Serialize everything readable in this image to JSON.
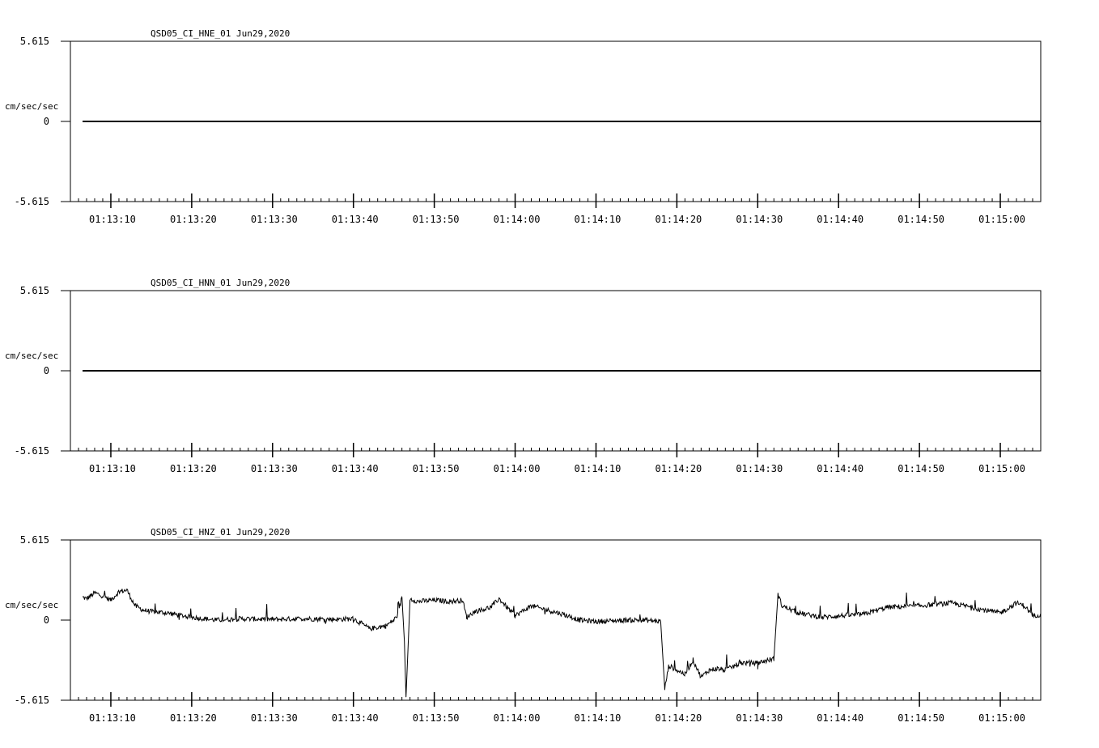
{
  "chart_data": [
    {
      "type": "line",
      "title": "QSD05_CI_HNE_01  Jun29,2020",
      "ylabel": "cm/sec/sec",
      "ylim": [
        -5.615,
        5.615
      ],
      "ytick_labels": [
        "5.615",
        "0",
        "-5.615"
      ],
      "xlim": [
        "01:13:05",
        "01:15:05"
      ],
      "xtick_labels": [
        "01:13:10",
        "01:13:20",
        "01:13:30",
        "01:13:40",
        "01:13:50",
        "01:14:00",
        "01:14:10",
        "01:14:20",
        "01:14:30",
        "01:14:40",
        "01:14:50",
        "01:15:00"
      ],
      "series": [
        {
          "x": [
            "01:13:06.5",
            "01:15:05"
          ],
          "y": [
            0,
            0
          ]
        }
      ]
    },
    {
      "type": "line",
      "title": "QSD05_CI_HNN_01  Jun29,2020",
      "ylabel": "cm/sec/sec",
      "ylim": [
        -5.615,
        5.615
      ],
      "ytick_labels": [
        "5.615",
        "0",
        "-5.615"
      ],
      "xlim": [
        "01:13:05",
        "01:15:05"
      ],
      "xtick_labels": [
        "01:13:10",
        "01:13:20",
        "01:13:30",
        "01:13:40",
        "01:13:50",
        "01:14:00",
        "01:14:10",
        "01:14:20",
        "01:14:30",
        "01:14:40",
        "01:14:50",
        "01:15:00"
      ],
      "series": [
        {
          "x": [
            "01:13:06.5",
            "01:15:05"
          ],
          "y": [
            0,
            0
          ]
        }
      ]
    },
    {
      "type": "line",
      "title": "QSD05_CI_HNZ_01  Jun29,2020",
      "ylabel": "cm/sec/sec",
      "ylim": [
        -5.615,
        5.615
      ],
      "ytick_labels": [
        "5.615",
        "0",
        "-5.615"
      ],
      "xlim": [
        "01:13:05",
        "01:15:05"
      ],
      "xtick_labels": [
        "01:13:10",
        "01:13:20",
        "01:13:30",
        "01:13:40",
        "01:13:50",
        "01:14:00",
        "01:14:10",
        "01:14:20",
        "01:14:30",
        "01:14:40",
        "01:14:50",
        "01:15:00"
      ],
      "series": [
        {
          "x": [
            "01:13:06.5",
            "01:13:07",
            "01:13:08",
            "01:13:09",
            "01:13:10",
            "01:13:11",
            "01:13:12",
            "01:13:13",
            "01:13:14",
            "01:13:15",
            "01:13:17",
            "01:13:20",
            "01:13:23",
            "01:13:26",
            "01:13:30",
            "01:13:34",
            "01:13:38",
            "01:13:40",
            "01:13:42",
            "01:13:44",
            "01:13:45",
            "01:13:45.5",
            "01:13:46",
            "01:13:46.3",
            "01:13:46.5",
            "01:13:47",
            "01:13:48",
            "01:13:50",
            "01:13:52",
            "01:13:53.5",
            "01:13:54",
            "01:13:55",
            "01:13:57",
            "01:13:58",
            "01:14:00",
            "01:14:02",
            "01:14:04",
            "01:14:06",
            "01:14:08",
            "01:14:10",
            "01:14:12",
            "01:14:14",
            "01:14:16",
            "01:14:18",
            "01:14:18.5",
            "01:14:19",
            "01:14:20",
            "01:14:21",
            "01:14:22",
            "01:14:23",
            "01:14:24",
            "01:14:25",
            "01:14:26",
            "01:14:28",
            "01:14:30",
            "01:14:32",
            "01:14:32.5",
            "01:14:33",
            "01:14:35",
            "01:14:38",
            "01:14:40",
            "01:14:43",
            "01:14:46",
            "01:14:50",
            "01:14:54",
            "01:14:58",
            "01:15:00",
            "01:15:02",
            "01:15:03",
            "01:15:04",
            "01:15:05"
          ],
          "y": [
            1.6,
            1.5,
            1.9,
            1.7,
            1.4,
            2.0,
            2.1,
            1.0,
            0.7,
            0.6,
            0.5,
            0.2,
            0.0,
            0.1,
            0.05,
            0.1,
            0.05,
            0.1,
            -0.6,
            -0.4,
            0.0,
            0.4,
            1.6,
            -1.5,
            -5.4,
            1.5,
            1.3,
            1.4,
            1.3,
            1.4,
            0.2,
            0.6,
            0.9,
            1.5,
            0.3,
            1.0,
            0.7,
            0.4,
            0.0,
            -0.1,
            -0.05,
            0.0,
            0.0,
            -0.1,
            -4.8,
            -3.2,
            -3.5,
            -3.8,
            -2.8,
            -4.0,
            -3.5,
            -3.4,
            -3.5,
            -3.0,
            -3.0,
            -2.7,
            1.8,
            1.0,
            0.5,
            0.2,
            0.3,
            0.4,
            0.9,
            1.0,
            1.2,
            0.7,
            0.5,
            1.2,
            1.0,
            0.3,
            0.4
          ]
        }
      ]
    }
  ]
}
